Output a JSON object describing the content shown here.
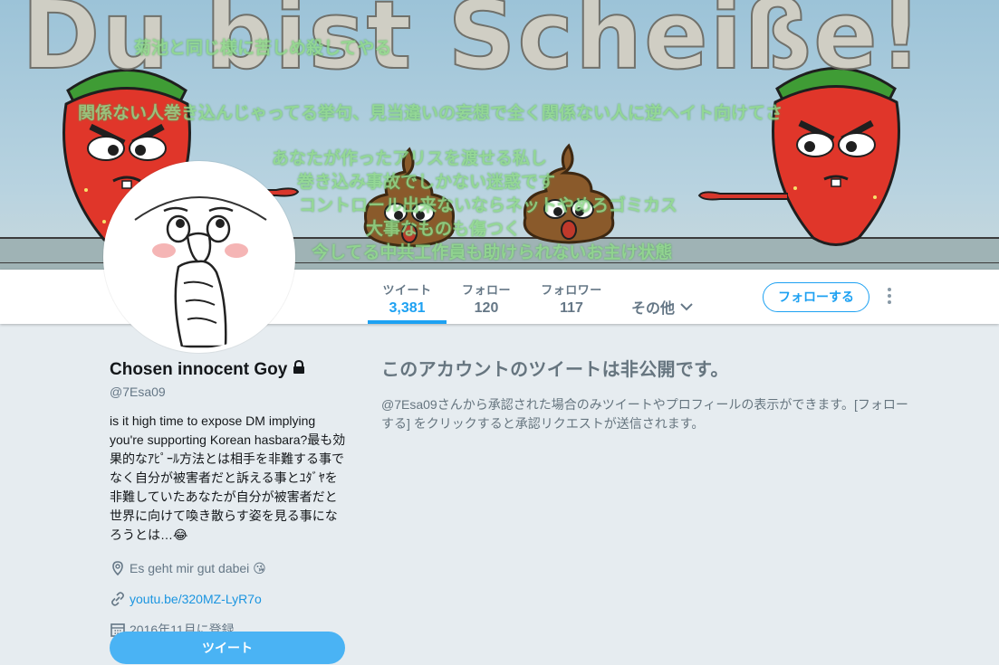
{
  "banner": {
    "title": "Du bist Scheiße!",
    "overlay_lines": [
      "菊池と同じ様に苦しめ殺してやる",
      "関係ない人巻き込んじゃってる挙句、見当違いの妄想で全く関係ない人に逆ヘイト向けてさ",
      "あなたが作ったアリスを渡せる私し",
      "巻き込み事故でしかない迷惑です",
      "コントロール出来ないならネットやめろゴミカス",
      "大事なものも傷つく",
      "今してる中共工作員も助けられないお主け状態"
    ]
  },
  "navbar": {
    "tabs": [
      {
        "label": "ツイート",
        "value": "3,381",
        "active": true
      },
      {
        "label": "フォロー",
        "value": "120",
        "active": false
      },
      {
        "label": "フォロワー",
        "value": "117",
        "active": false
      }
    ],
    "more_label": "その他",
    "follow_label": "フォローする"
  },
  "profile": {
    "name": "Chosen innocent Goy",
    "handle": "@7Esa09",
    "bio": "is it high time to expose DM implying you're supporting Korean hasbara?最も効果的なｱﾋﾟｰﾙ方法とは相手を非難する事でなく自分が被害者だと訴える事とﾕﾀﾞﾔを非難していたあなたが自分が被害者だと世界に向けて喚き散らす姿を見る事になろうとは…😂",
    "location": "Es geht mir gut dabei 😘",
    "url": "youtu.be/320MZ-LyR7o",
    "joined": "2016年11月に登録",
    "tweet_button": "ツイート"
  },
  "protected": {
    "heading": "このアカウントのツイートは非公開です。",
    "message": "@7Esa09さんから承認された場合のみツイートやプロフィールの表示ができます。[フォローする] をクリックすると承認リクエストが送信されます。"
  },
  "colors": {
    "accent": "#1da1f2",
    "background": "#e6ecf0",
    "tweet_button": "#4ab3f4"
  }
}
